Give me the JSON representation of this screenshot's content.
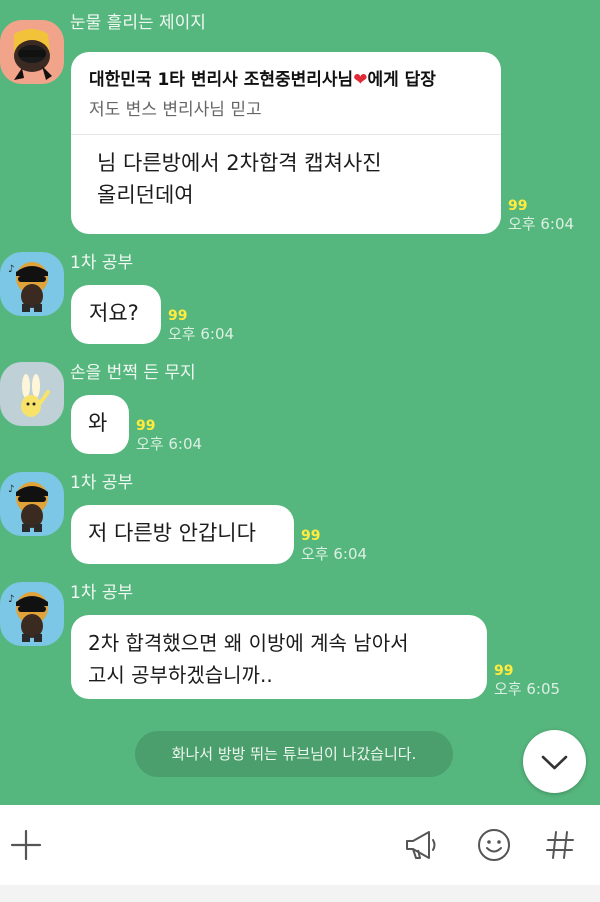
{
  "messages": [
    {
      "sender": "눈물 흘리는 제이지",
      "reply_target_prefix": "대한민국 1타 변리사 조현중변리사님",
      "reply_target_heart": "❤",
      "reply_target_suffix": "에게 답장",
      "reply_quote": "저도 변스 변리사님 믿고",
      "text": "님 다른방에서 2차합격 캡쳐사진\n올리던데여",
      "unread": "99",
      "time": "오후 6:04"
    },
    {
      "sender": "1차 공부",
      "text": "저요?",
      "unread": "99",
      "time": "오후 6:04"
    },
    {
      "sender": "손을 번쩍 든 무지",
      "text": "와",
      "unread": "99",
      "time": "오후 6:04"
    },
    {
      "sender": "1차 공부",
      "text": "저 다른방 안갑니다",
      "unread": "99",
      "time": "오후 6:04"
    },
    {
      "sender": "1차 공부",
      "text": "2차 합격했으면 왜 이방에 계속 남아서\n고시 공부하겠습니까..",
      "unread": "99",
      "time": "오후 6:05"
    }
  ],
  "notice": "화나서 방방 뛰는 튜브님이 나갔습니다.",
  "icons": {
    "scroll_down": "chevron-down-icon",
    "add": "plus-icon",
    "megaphone": "megaphone-icon",
    "emoticon": "emoticon-icon",
    "hashtag": "hashtag-icon"
  },
  "colors": {
    "background": "#56b77e",
    "bubble": "#ffffff",
    "unread": "#ffec3f",
    "notice_bg": "#4a9f6c",
    "heart": "#e02a36"
  }
}
